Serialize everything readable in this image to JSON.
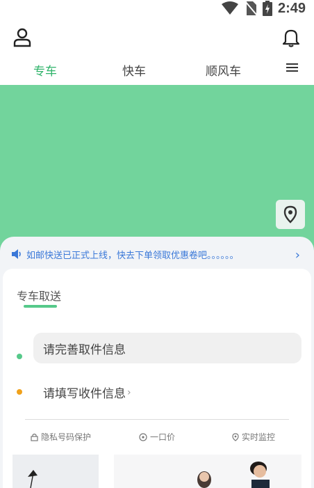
{
  "status_bar": {
    "time": "2:49"
  },
  "tabs": [
    {
      "label": "专车",
      "active": true
    },
    {
      "label": "快车",
      "active": false
    },
    {
      "label": "顺风车",
      "active": false
    }
  ],
  "notice": {
    "text": "如邮快送已正式上线，快去下单领取优惠卷吧。。。。。。"
  },
  "card": {
    "title": "专车取送",
    "pickup_label": "请完善取件信息",
    "delivery_label": "请填写收件信息",
    "features": [
      "隐私号码保护",
      "一口价",
      "实时监控"
    ]
  },
  "colors": {
    "accent_green": "#2fb36a",
    "map_green": "#72d49c",
    "notice_blue": "#3a78d8",
    "dot_orange": "#f0a11b"
  },
  "icons": [
    "wifi-icon",
    "no-sim-icon",
    "battery-icon",
    "user-icon",
    "bell-icon",
    "menu-icon",
    "location-pin-icon",
    "speaker-icon",
    "chevron-right-icon",
    "lock-icon",
    "price-icon",
    "monitor-icon"
  ]
}
